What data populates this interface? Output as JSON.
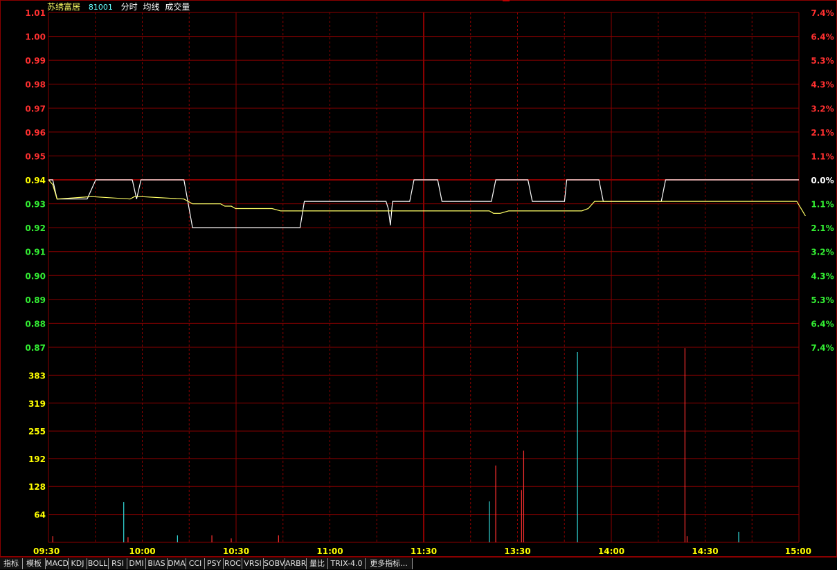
{
  "header": {
    "name": "苏绣富居",
    "code": "81001",
    "labels": [
      "分时",
      "均线",
      "成交量"
    ]
  },
  "colors": {
    "grid": "#8b0000",
    "up": "#ff3030",
    "down": "#33ee33",
    "flat": "#ffff00",
    "price_line": "#ffffff",
    "avg_line": "#ffff66",
    "vol_up": "#ff3030",
    "vol_down": "#33dddd"
  },
  "chart_data": {
    "type": "line",
    "prev_close": 0.94,
    "price_axis": {
      "ticks": [
        "1.01",
        "1.00",
        "0.99",
        "0.98",
        "0.97",
        "0.96",
        "0.95",
        "0.94",
        "0.93",
        "0.92",
        "0.91",
        "0.90",
        "0.89",
        "0.88",
        "0.87"
      ],
      "values": [
        1.01,
        1.0,
        0.99,
        0.98,
        0.97,
        0.96,
        0.95,
        0.94,
        0.93,
        0.92,
        0.91,
        0.9,
        0.89,
        0.88,
        0.87
      ],
      "pct_labels": [
        "7.4%",
        "6.4%",
        "5.3%",
        "4.3%",
        "3.2%",
        "2.1%",
        "1.1%",
        "0.0%",
        "1.1%",
        "2.1%",
        "3.2%",
        "4.3%",
        "5.3%",
        "6.4%",
        "7.4%"
      ],
      "ylim": [
        0.87,
        1.01
      ]
    },
    "volume_axis": {
      "ticks": [
        "383",
        "319",
        "255",
        "192",
        "128",
        "64"
      ],
      "values": [
        383,
        319,
        255,
        192,
        128,
        64
      ],
      "ylim": [
        0,
        447
      ]
    },
    "time_axis": {
      "labels": [
        "09:30",
        "10:00",
        "10:30",
        "11:00",
        "11:30",
        "13:30",
        "14:00",
        "14:30",
        "15:00"
      ],
      "minute_index": [
        0,
        30,
        60,
        90,
        120,
        150,
        180,
        210,
        240
      ],
      "total_minutes": 240
    },
    "series": [
      {
        "name": "分时",
        "points": [
          [
            0,
            0.94
          ],
          [
            2,
            0.94
          ],
          [
            4,
            0.932
          ],
          [
            18,
            0.932
          ],
          [
            22,
            0.94
          ],
          [
            39,
            0.94
          ],
          [
            41,
            0.932
          ],
          [
            43,
            0.94
          ],
          [
            63,
            0.94
          ],
          [
            67,
            0.92
          ],
          [
            117,
            0.92
          ],
          [
            119,
            0.931
          ],
          [
            157,
            0.931
          ],
          [
            158,
            0.928
          ],
          [
            159,
            0.921
          ],
          [
            160,
            0.931
          ],
          [
            168,
            0.931
          ],
          [
            170,
            0.94
          ],
          [
            181,
            0.94
          ],
          [
            183,
            0.931
          ],
          [
            206,
            0.931
          ],
          [
            208,
            0.94
          ],
          [
            223,
            0.94
          ],
          [
            225,
            0.931
          ],
          [
            240,
            0.931
          ],
          [
            241,
            0.94
          ],
          [
            256,
            0.94
          ],
          [
            258,
            0.931
          ],
          [
            285,
            0.931
          ],
          [
            287,
            0.94
          ],
          [
            349,
            0.94
          ]
        ]
      },
      {
        "name": "均线",
        "points": [
          [
            0,
            0.94
          ],
          [
            2,
            0.938
          ],
          [
            4,
            0.932
          ],
          [
            20,
            0.933
          ],
          [
            38,
            0.932
          ],
          [
            40,
            0.933
          ],
          [
            43,
            0.933
          ],
          [
            63,
            0.932
          ],
          [
            67,
            0.93
          ],
          [
            80,
            0.93
          ],
          [
            82,
            0.929
          ],
          [
            85,
            0.929
          ],
          [
            87,
            0.928
          ],
          [
            104,
            0.928
          ],
          [
            108,
            0.927
          ],
          [
            190,
            0.927
          ],
          [
            205,
            0.927
          ],
          [
            207,
            0.926
          ],
          [
            210,
            0.926
          ],
          [
            214,
            0.927
          ],
          [
            248,
            0.927
          ],
          [
            251,
            0.928
          ],
          [
            254,
            0.931
          ],
          [
            348,
            0.931
          ],
          [
            352,
            0.925
          ]
        ]
      }
    ],
    "volume": [
      {
        "x": 2,
        "v": 14,
        "c": "up"
      },
      {
        "x": 35,
        "v": 92,
        "c": "down"
      },
      {
        "x": 37,
        "v": 12,
        "c": "up"
      },
      {
        "x": 60,
        "v": 16,
        "c": "down"
      },
      {
        "x": 76,
        "v": 16,
        "c": "up"
      },
      {
        "x": 85,
        "v": 9,
        "c": "up"
      },
      {
        "x": 107,
        "v": 16,
        "c": "up"
      },
      {
        "x": 205,
        "v": 94,
        "c": "down"
      },
      {
        "x": 208,
        "v": 176,
        "c": "up"
      },
      {
        "x": 220,
        "v": 120,
        "c": "up"
      },
      {
        "x": 221,
        "v": 210,
        "c": "up"
      },
      {
        "x": 246,
        "v": 436,
        "c": "down"
      },
      {
        "x": 296,
        "v": 445,
        "c": "up"
      },
      {
        "x": 297,
        "v": 14,
        "c": "up"
      },
      {
        "x": 321,
        "v": 24,
        "c": "down"
      }
    ]
  },
  "tabs": [
    "指标",
    "模板",
    "MACD",
    "KDJ",
    "BOLL",
    "RSI",
    "DMI",
    "BIAS",
    "DMA",
    "CCI",
    "PSY",
    "ROC",
    "VRSI",
    "SOBV",
    "ARBR",
    "量比",
    "TRIX-4.0",
    "更多指标..."
  ]
}
